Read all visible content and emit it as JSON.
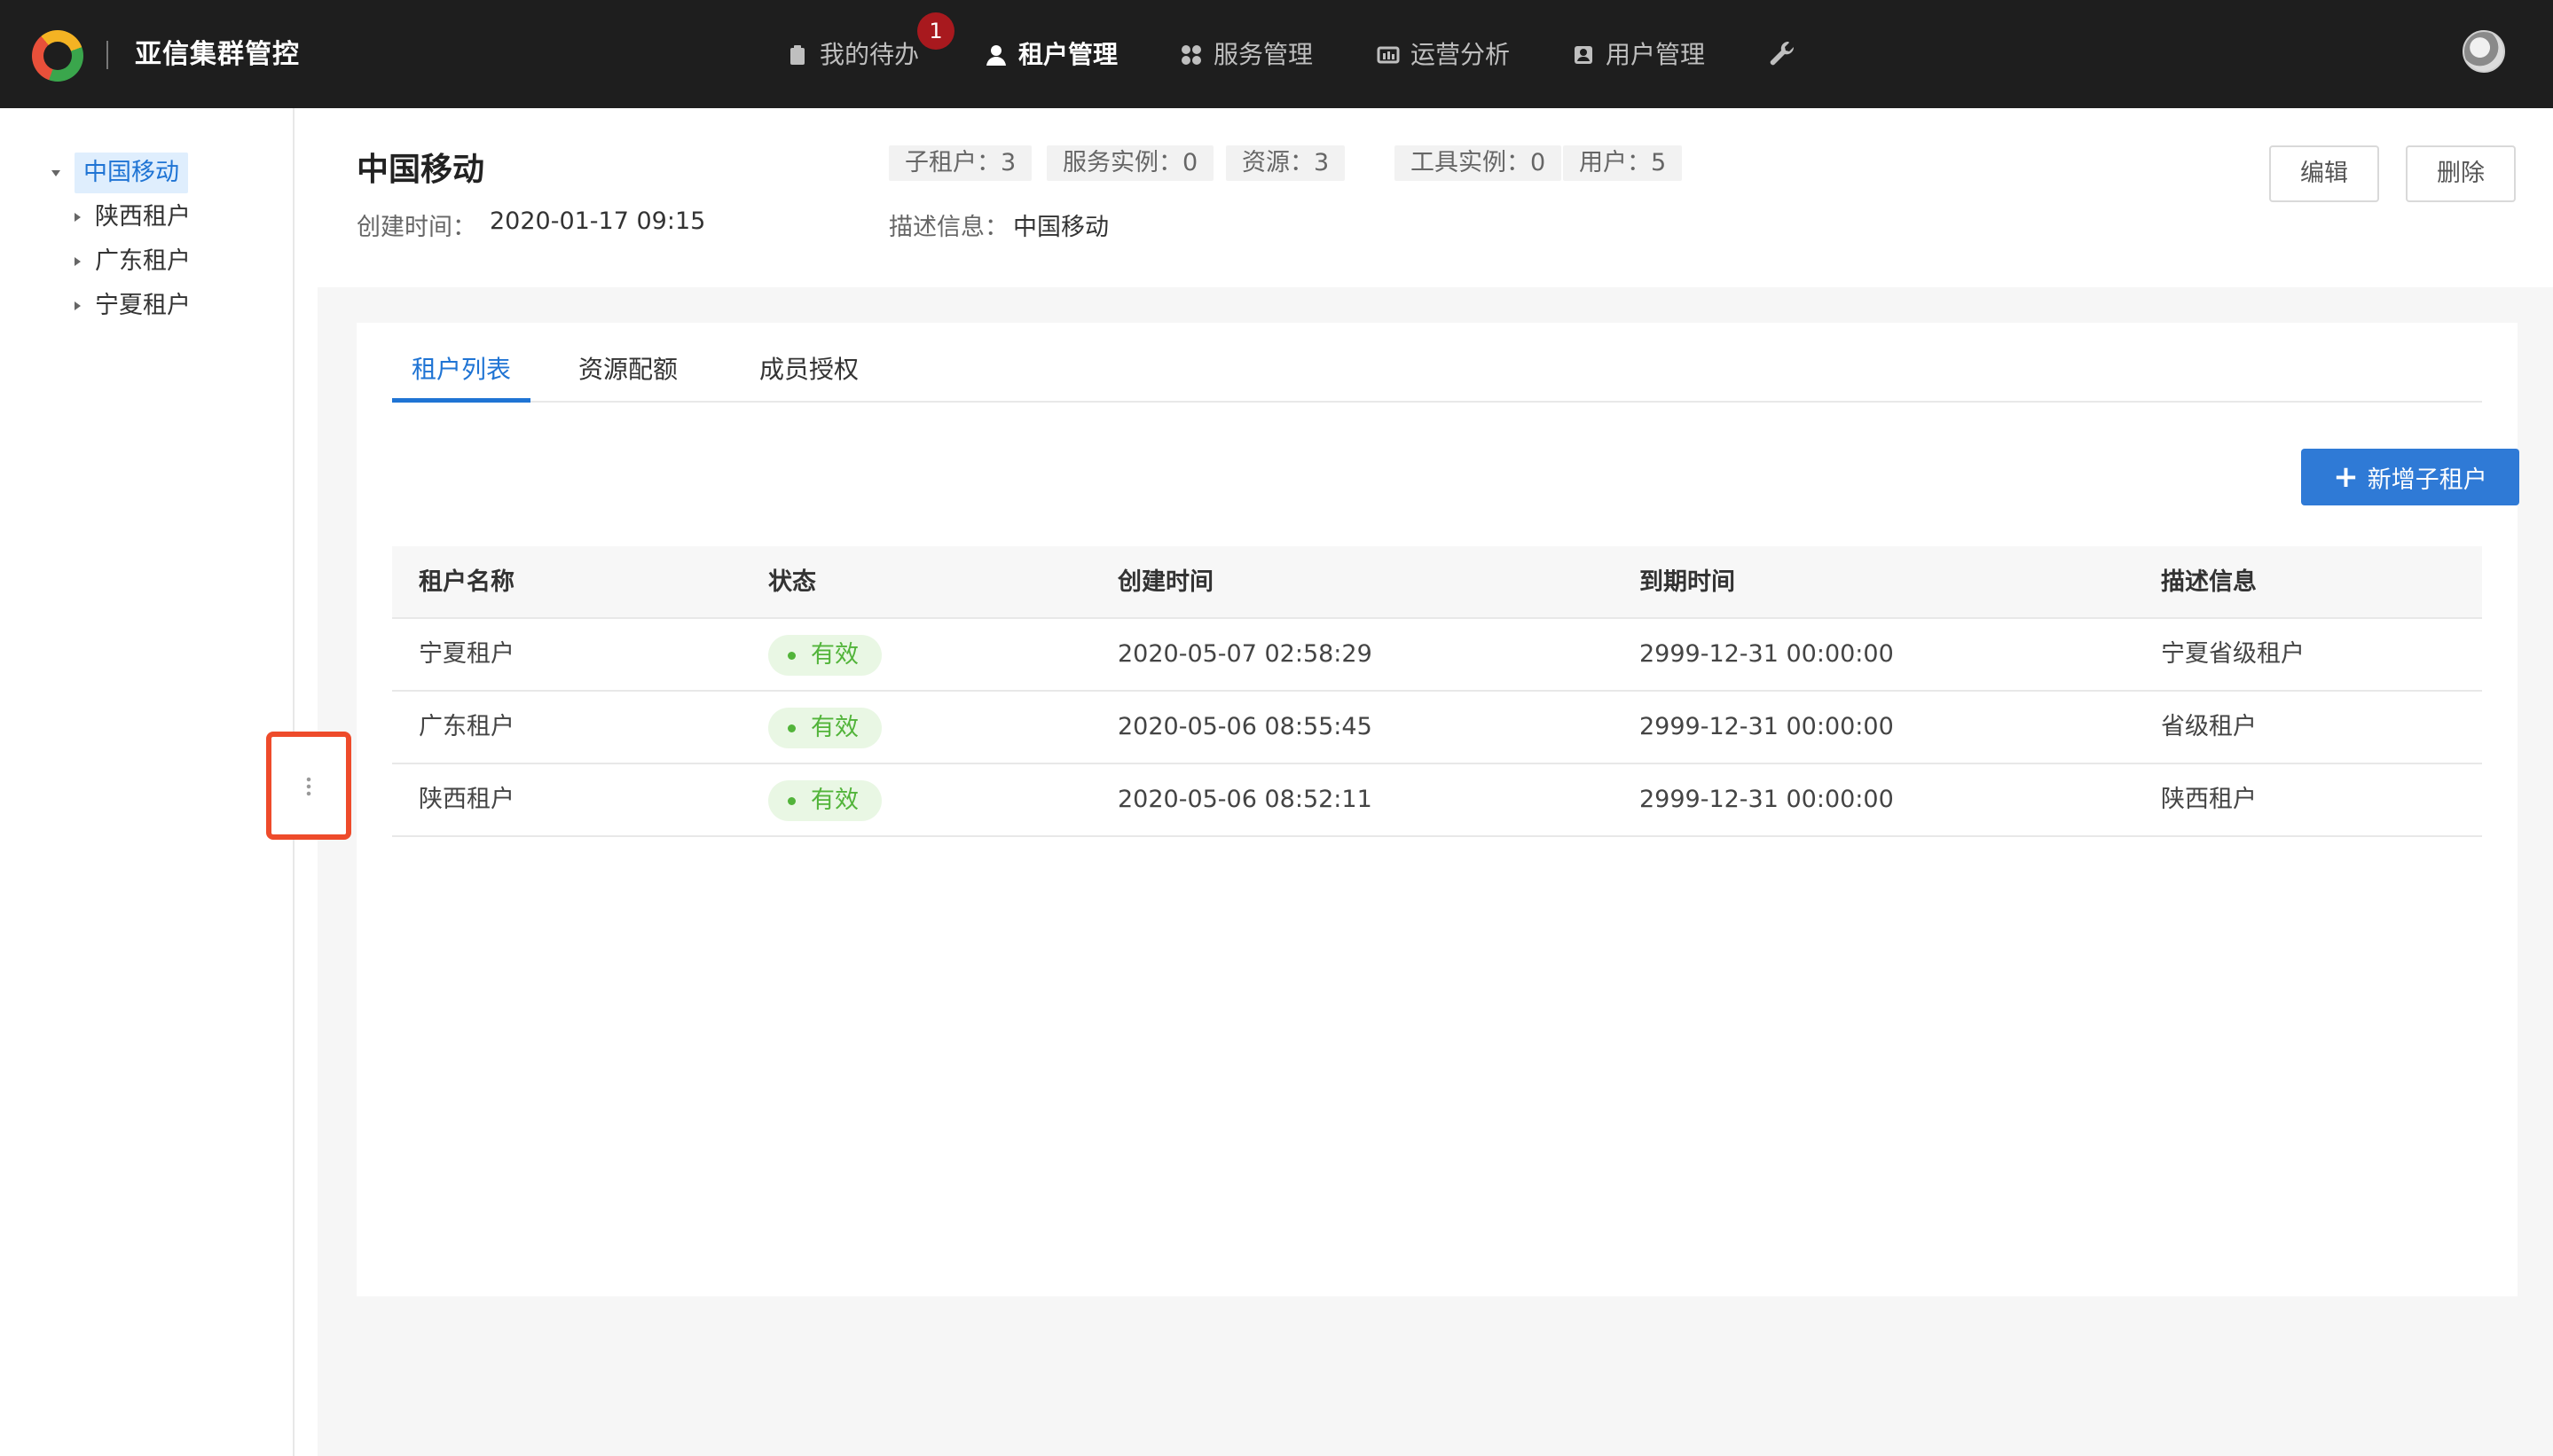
{
  "app": {
    "title": "亚信集群管控",
    "nav": [
      {
        "label": "我的待办",
        "icon": "clipboard-icon",
        "badge": "1",
        "active": false
      },
      {
        "label": "租户管理",
        "icon": "user-icon",
        "active": true
      },
      {
        "label": "服务管理",
        "icon": "grid-icon",
        "active": false
      },
      {
        "label": "运营分析",
        "icon": "chart-icon",
        "active": false
      },
      {
        "label": "用户管理",
        "icon": "id-card-icon",
        "active": false
      }
    ]
  },
  "tree": {
    "root": "中国移动",
    "children": [
      "陕西租户",
      "广东租户",
      "宁夏租户"
    ]
  },
  "tenant": {
    "name": "中国移动",
    "created_label": "创建时间：",
    "created_value": "2020-01-17 09:15",
    "desc_label": "描述信息：",
    "desc_value": "中国移动",
    "stats": [
      "子租户：3",
      "服务实例：0",
      "资源：3",
      "工具实例：0",
      "用户：5"
    ],
    "edit_label": "编辑",
    "delete_label": "删除"
  },
  "tabs": [
    "租户列表",
    "资源配额",
    "成员授权"
  ],
  "add_button": "新增子租户",
  "table": {
    "headers": [
      "租户名称",
      "状态",
      "创建时间",
      "到期时间",
      "描述信息"
    ],
    "rows": [
      [
        "宁夏租户",
        "有效",
        "2020-05-07 02:58:29",
        "2999-12-31 00:00:00",
        "宁夏省级租户"
      ],
      [
        "广东租户",
        "有效",
        "2020-05-06 08:55:45",
        "2999-12-31 00:00:00",
        "省级租户"
      ],
      [
        "陕西租户",
        "有效",
        "2020-05-06 08:52:11",
        "2999-12-31 00:00:00",
        "陕西租户"
      ]
    ]
  },
  "colors": {
    "navbar": "#1e1e1e",
    "accent": "#1f74d4",
    "primary_button": "#2f7ad6",
    "status_ok": "#52b43a",
    "badge": "#a8191e",
    "highlight_border": "#ee4b2b"
  }
}
